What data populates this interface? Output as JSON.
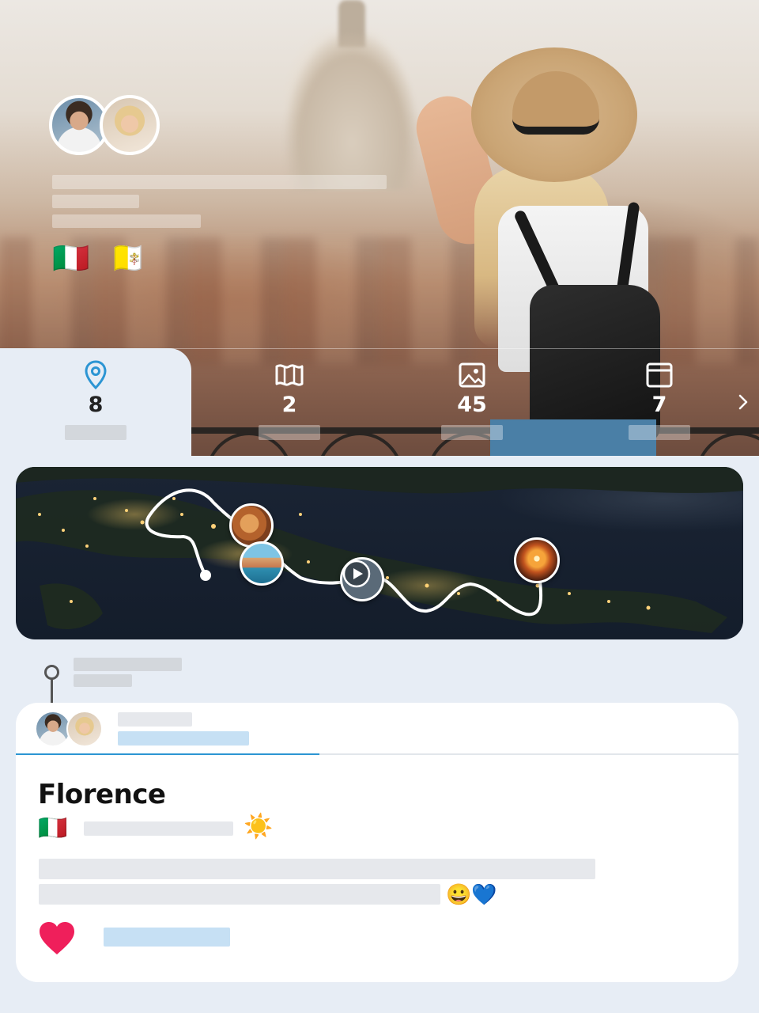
{
  "hero": {
    "flags": [
      "🇮🇹",
      "🇻🇦"
    ],
    "stats": [
      {
        "icon": "location-pin-icon",
        "value": "8",
        "active": true
      },
      {
        "icon": "map-icon",
        "value": "2",
        "active": false
      },
      {
        "icon": "gallery-icon",
        "value": "45",
        "active": false
      },
      {
        "icon": "calendar-icon",
        "value": "7",
        "active": false
      }
    ]
  },
  "map": {
    "stops": [
      "pizza-photo",
      "coast-photo",
      "video-play",
      "sunset-photo"
    ]
  },
  "post": {
    "title": "Florence",
    "flag": "🇮🇹",
    "weather_emoji": "☀️",
    "reaction_emojis": "😀💙",
    "like_icon": "heart-icon"
  },
  "colors": {
    "accent": "#2c95d3",
    "like": "#ef1f5b",
    "background": "#e7edf5"
  }
}
